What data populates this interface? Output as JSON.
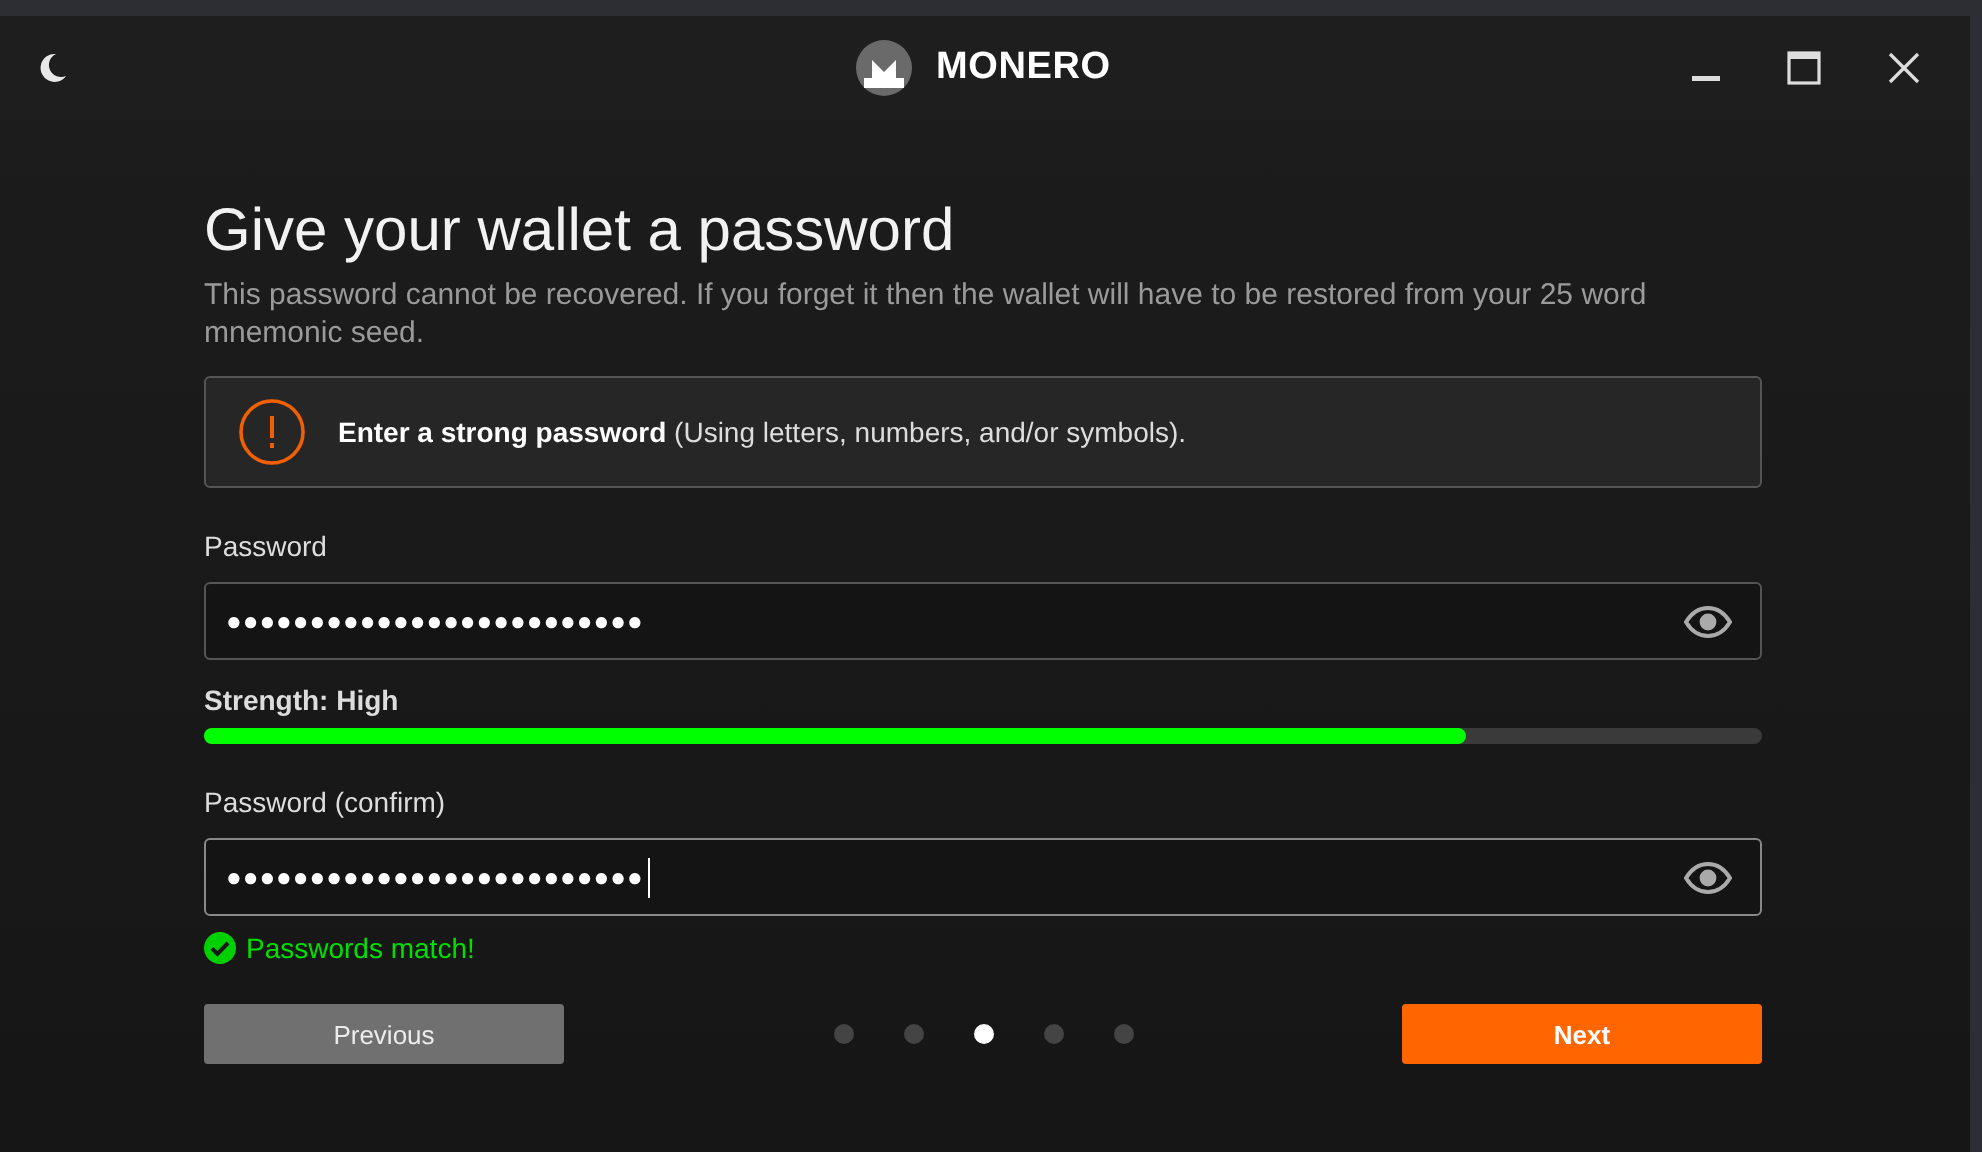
{
  "window": {
    "title": "MONERO"
  },
  "heading": "Give your wallet a password",
  "description": "This password cannot be recovered. If you forget it then the wallet will have to be restored from your 25 word mnemonic seed.",
  "notice": {
    "text": "**Enter a strong password** (Using letters, numbers, and/or symbols)."
  },
  "fields": [
    {
      "label": "Password",
      "value": "●●●●●●●●●●●●●●●●●●●●●●●●●",
      "focused": false
    },
    {
      "label": "Password (confirm)",
      "value": "●●●●●●●●●●●●●●●●●●●●●●●●●",
      "focused": true
    }
  ],
  "strength": {
    "label": "Strength: High",
    "level": 0.81
  },
  "match": {
    "text": "Passwords match!"
  },
  "buttons": {
    "previous": "Previous",
    "next": "Next"
  },
  "steps": [
    {
      "selected": false
    },
    {
      "selected": false
    },
    {
      "selected": true
    },
    {
      "selected": false
    },
    {
      "selected": false
    }
  ]
}
